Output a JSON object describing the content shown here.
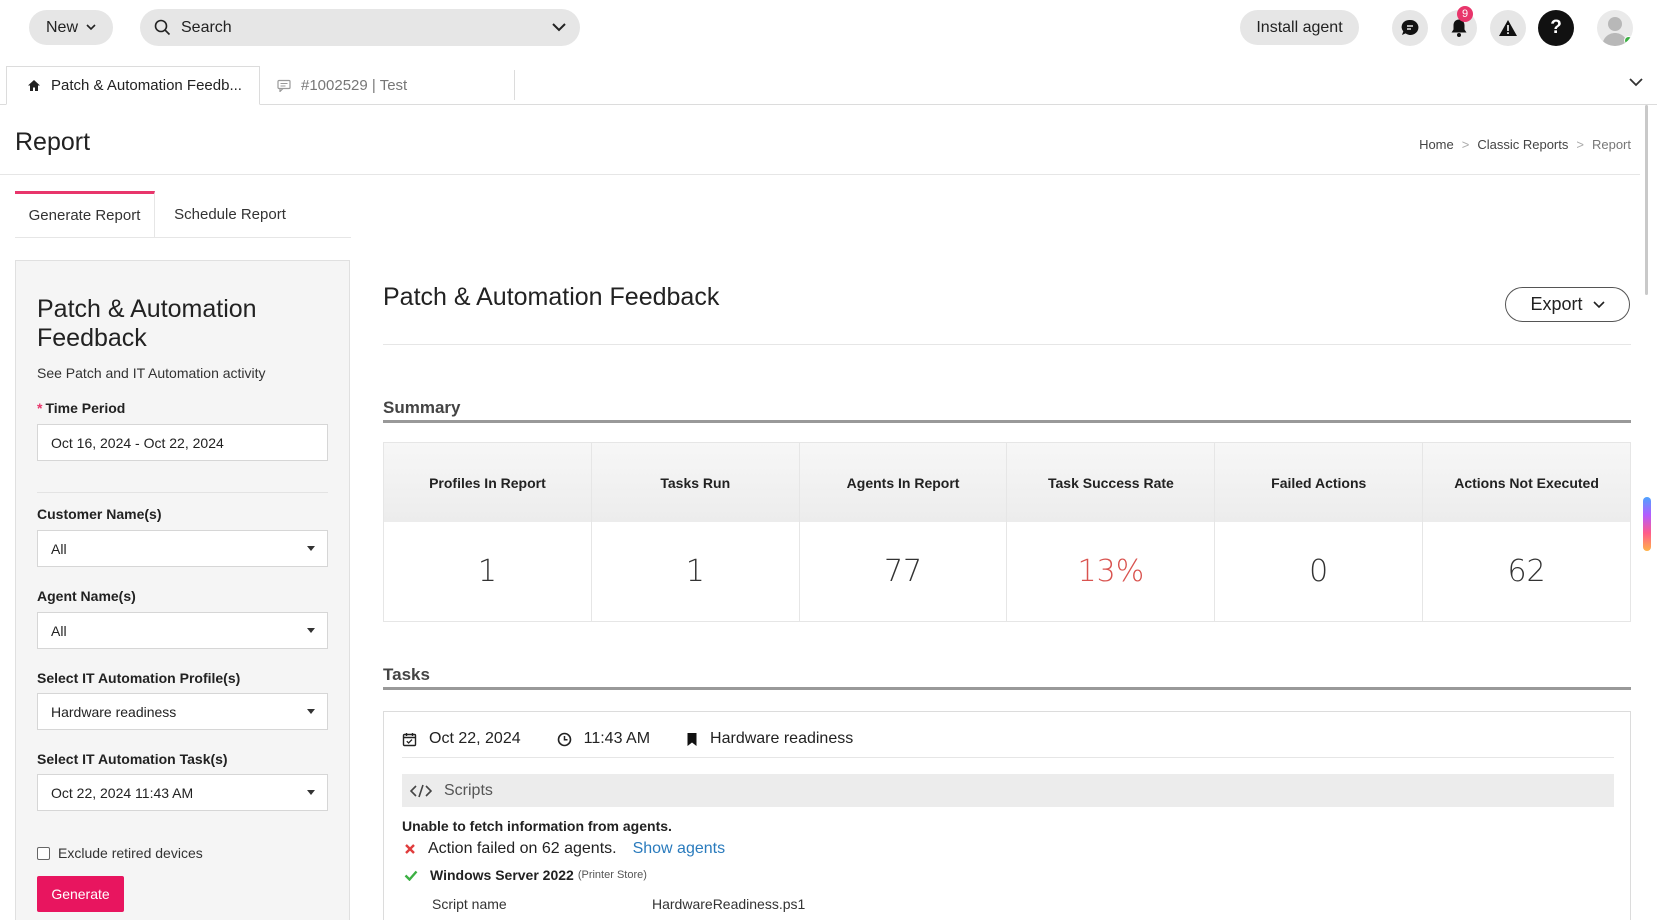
{
  "topbar": {
    "new_label": "New",
    "search_label": "Search",
    "install_label": "Install agent",
    "notification_count": "9",
    "help_label": "?"
  },
  "tabs": [
    {
      "label": "Patch & Automation Feedb...",
      "icon": "home-icon",
      "active": true
    },
    {
      "label": "#1002529 | Test",
      "icon": "ticket-icon",
      "active": false
    }
  ],
  "page": {
    "title": "Report",
    "breadcrumb": [
      "Home",
      "Classic Reports",
      "Report"
    ]
  },
  "report_tabs": [
    "Generate Report",
    "Schedule Report"
  ],
  "left_panel": {
    "title": "Patch & Automation Feedback",
    "subtitle": "See Patch and IT Automation activity",
    "time_period_label": "Time Period",
    "time_period_value": "Oct 16, 2024 - Oct 22, 2024",
    "customer_label": "Customer Name(s)",
    "customer_value": "All",
    "agent_label": "Agent Name(s)",
    "agent_value": "All",
    "profile_label": "Select IT Automation Profile(s)",
    "profile_value": "Hardware readiness",
    "task_label": "Select IT Automation Task(s)",
    "task_value": "Oct 22, 2024 11:43 AM",
    "exclude_label": "Exclude retired devices",
    "generate_label": "Generate"
  },
  "main": {
    "title": "Patch & Automation Feedback",
    "export_label": "Export",
    "summary_heading": "Summary",
    "summary": [
      {
        "label": "Profiles In Report",
        "value": "1"
      },
      {
        "label": "Tasks Run",
        "value": "1"
      },
      {
        "label": "Agents In Report",
        "value": "77"
      },
      {
        "label": "Task Success Rate",
        "value": "13%"
      },
      {
        "label": "Failed Actions",
        "value": "0"
      },
      {
        "label": "Actions Not Executed",
        "value": "62"
      }
    ],
    "warn_color": "#d9534f",
    "tasks_heading": "Tasks",
    "task": {
      "date": "Oct 22, 2024",
      "time": "11:43 AM",
      "profile": "Hardware readiness",
      "scripts_label": "Scripts",
      "error_text": "Unable to fetch information from agents.",
      "fail_text": "Action failed on 62 agents.",
      "show_agents": "Show agents",
      "ok_name": "Windows Server 2022",
      "ok_sub": "(Printer Store)",
      "row_key": "Script name",
      "row_value": "HardwareReadiness.ps1"
    }
  },
  "colors": {
    "accent": "#e8155f",
    "link": "#2a7bbd",
    "success": "#3cb043",
    "fail": "#e03c3c"
  }
}
